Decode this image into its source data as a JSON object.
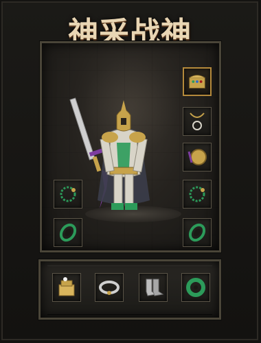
{
  "title": {
    "text": "神采战神",
    "level": "180"
  },
  "character": {
    "name": "armored-warrior",
    "accent": "#7d3ca0",
    "armor": "#d8d4c8",
    "trim": "#c7a34b"
  },
  "equipment": {
    "left_column": [
      {
        "name": "green-bead-bracelet-slot",
        "icon": "bracelet-icon"
      },
      {
        "name": "green-jade-bracelet-slot",
        "icon": "jade-bracelet-icon"
      }
    ],
    "right_column": [
      {
        "name": "treasure-chest-slot",
        "icon": "treasure-chest-icon"
      },
      {
        "name": "pendant-necklace-slot",
        "icon": "necklace-icon"
      },
      {
        "name": "round-medal-slot",
        "icon": "medal-icon"
      },
      {
        "name": "green-bead-bracelet-slot-right",
        "icon": "bracelet-icon"
      },
      {
        "name": "green-jade-bracelet-slot-right",
        "icon": "jade-bracelet-icon"
      }
    ],
    "bottom_row": [
      {
        "name": "gold-box-slot",
        "icon": "gold-box-icon"
      },
      {
        "name": "silver-belt-slot",
        "icon": "belt-icon"
      },
      {
        "name": "silver-boots-slot",
        "icon": "boots-icon"
      },
      {
        "name": "jade-ring-slot",
        "icon": "jade-ring-icon"
      }
    ]
  },
  "colors": {
    "gold": "#b58a3b",
    "blood": "#a0191c",
    "green_jade": "#2c9b5a",
    "panel_border": "#4a4538"
  }
}
